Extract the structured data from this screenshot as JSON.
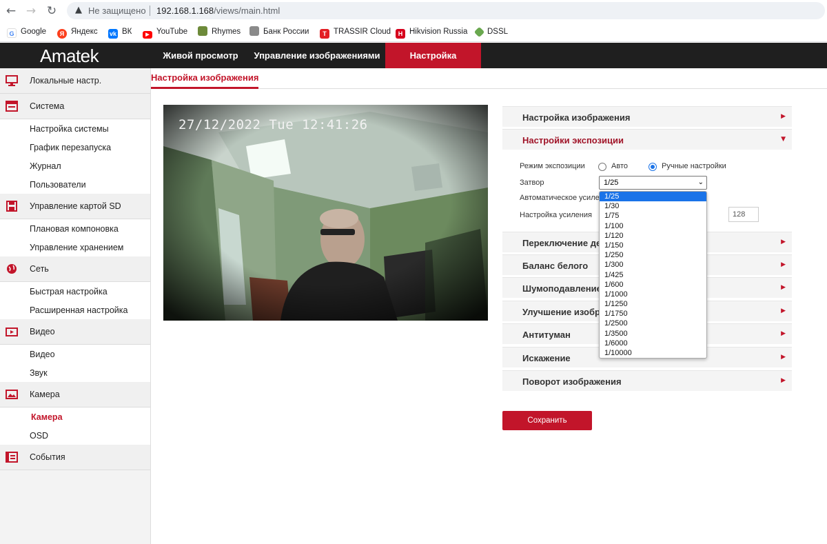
{
  "browser": {
    "security_label": "Не защищено",
    "url_host": "192.168.1.168",
    "url_path": "/views/main.html",
    "bookmarks": [
      "Google",
      "Яндекс",
      "ВК",
      "YouTube",
      "Rhymes",
      "Банк России",
      "TRASSIR Cloud",
      "Hikvision Russia",
      "DSSL"
    ]
  },
  "header": {
    "logo": "Amatek",
    "nav": [
      "Живой просмотр",
      "Управление изображениями",
      "Настройка"
    ]
  },
  "sidebar": {
    "local": "Локальные настр.",
    "system": "Система",
    "system_items": [
      "Настройка системы",
      "График перезапуска",
      "Журнал",
      "Пользователи"
    ],
    "sd": "Управление картой SD",
    "sd_items": [
      "Плановая компоновка",
      "Управление хранением"
    ],
    "network": "Сеть",
    "network_items": [
      "Быстрая настройка",
      "Расширенная настройка"
    ],
    "video": "Видео",
    "video_items": [
      "Видео",
      "Звук"
    ],
    "camera": "Камера",
    "camera_items": [
      "Камера",
      "OSD"
    ],
    "events": "События"
  },
  "page": {
    "tab": "Настройка изображения",
    "osd_text": "27/12/2022 Tue 12:41:26"
  },
  "accordion": {
    "image": "Настройка изображения",
    "exposure": "Настройки экспозиции",
    "daynight": "Переключение де",
    "wb": "Баланс белого",
    "noise": "Шумоподавление",
    "enhance": "Улучшение изобр",
    "defog": "Антитуман",
    "distortion": "Искажение",
    "rotate": "Поворот изображения"
  },
  "exposure": {
    "mode_label": "Режим экспозиции",
    "auto_label": "Авто",
    "manual_label": "Ручные настройки",
    "mode_value": "manual",
    "shutter_label": "Затвор",
    "shutter_value": "1/25",
    "auto_gain_label": "Автоматическое усиле",
    "gain_label": "Настройка усиления",
    "gain_value": "128",
    "shutter_options": [
      "1/25",
      "1/30",
      "1/75",
      "1/100",
      "1/120",
      "1/150",
      "1/250",
      "1/300",
      "1/425",
      "1/600",
      "1/1000",
      "1/1250",
      "1/1750",
      "1/2500",
      "1/3500",
      "1/6000",
      "1/10000"
    ]
  },
  "save_label": "Сохранить",
  "colors": {
    "accent": "#c2152a",
    "header_bg": "#1f1f1f",
    "select_highlight": "#1a73e8"
  }
}
